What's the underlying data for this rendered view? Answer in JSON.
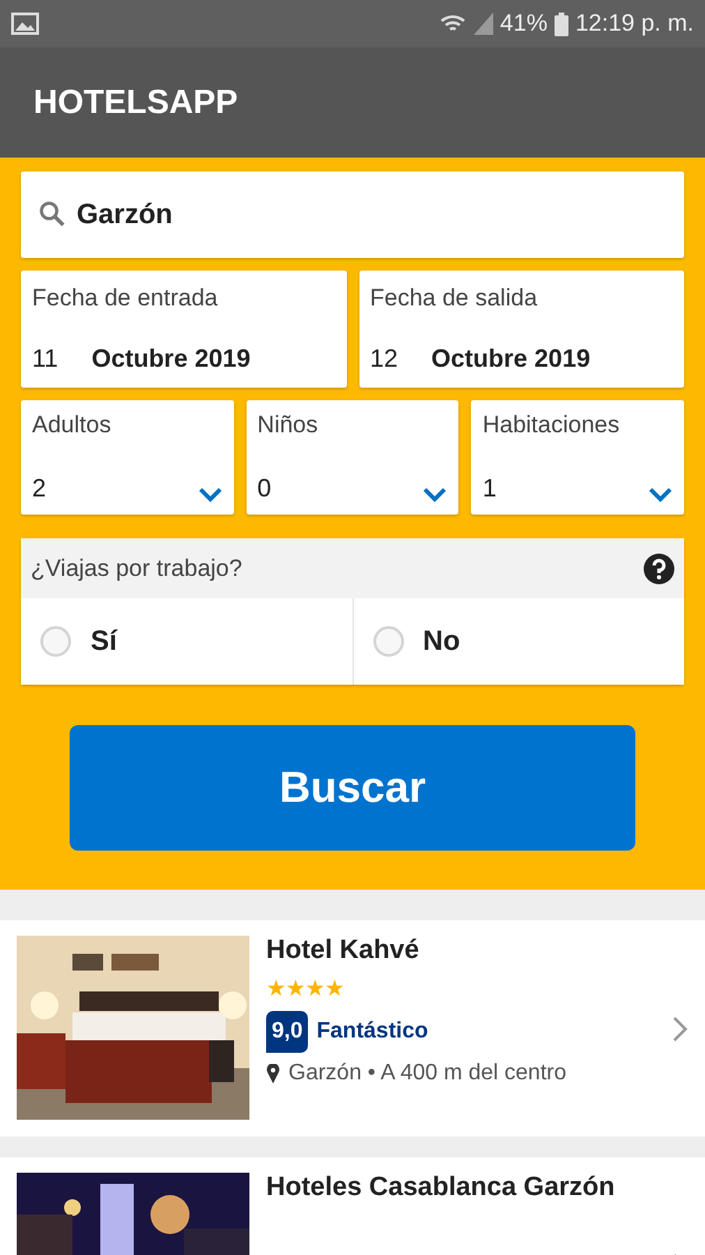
{
  "status_bar": {
    "battery": "41%",
    "time": "12:19 p. m."
  },
  "app_bar": {
    "title": "HOTELSAPP"
  },
  "search": {
    "value": "Garzón"
  },
  "dates": [
    {
      "label": "Fecha de entrada",
      "day": "11",
      "month": "Octubre 2019"
    },
    {
      "label": "Fecha de salida",
      "day": "12",
      "month": "Octubre 2019"
    }
  ],
  "guests": [
    {
      "label": "Adultos",
      "value": "2"
    },
    {
      "label": "Niños",
      "value": "0"
    },
    {
      "label": "Habitaciones",
      "value": "1"
    }
  ],
  "business_trip": {
    "question": "¿Viajas por trabajo?",
    "options": [
      {
        "label": "Sí",
        "selected": false
      },
      {
        "label": "No",
        "selected": false
      }
    ]
  },
  "search_button": "Buscar",
  "hotels": [
    {
      "name": "Hotel Kahvé",
      "stars": 4,
      "score": "9,0",
      "rating": "Fantástico",
      "location": "Garzón • A 400 m del centro"
    },
    {
      "name": "Hoteles Casablanca Garzón"
    }
  ]
}
